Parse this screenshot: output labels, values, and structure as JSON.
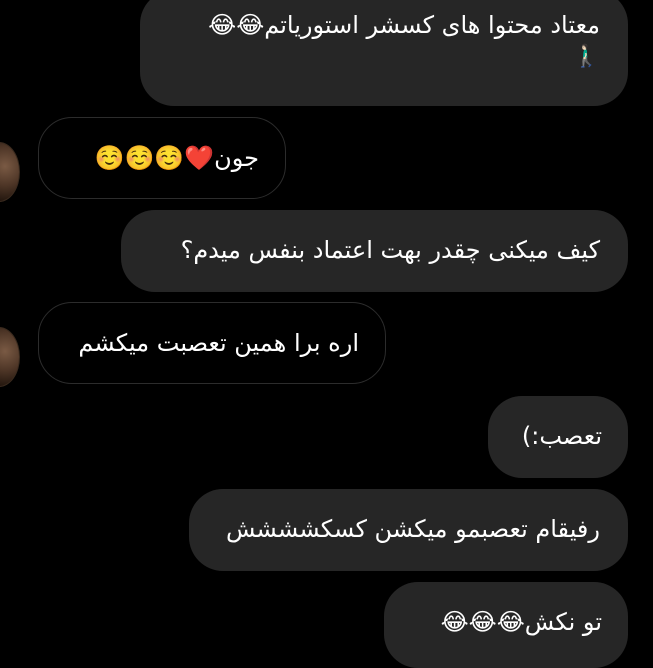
{
  "messages": [
    {
      "text": "معتاد محتوا های کسشر استوریاتم😂😂",
      "line2": "🚶🏻‍♂️"
    },
    {
      "text": "جون❤️☺️☺️☺️"
    },
    {
      "text": "کیف میکنی چقدر بهت اعتماد بنفس میدم؟"
    },
    {
      "text": "اره برا همین تعصبت میکشم"
    },
    {
      "text": "تعصب:)"
    },
    {
      "text": "رفیقام تعصبمو میکشن کسکشششش"
    },
    {
      "text": "تو نکش😂😂😂"
    }
  ]
}
